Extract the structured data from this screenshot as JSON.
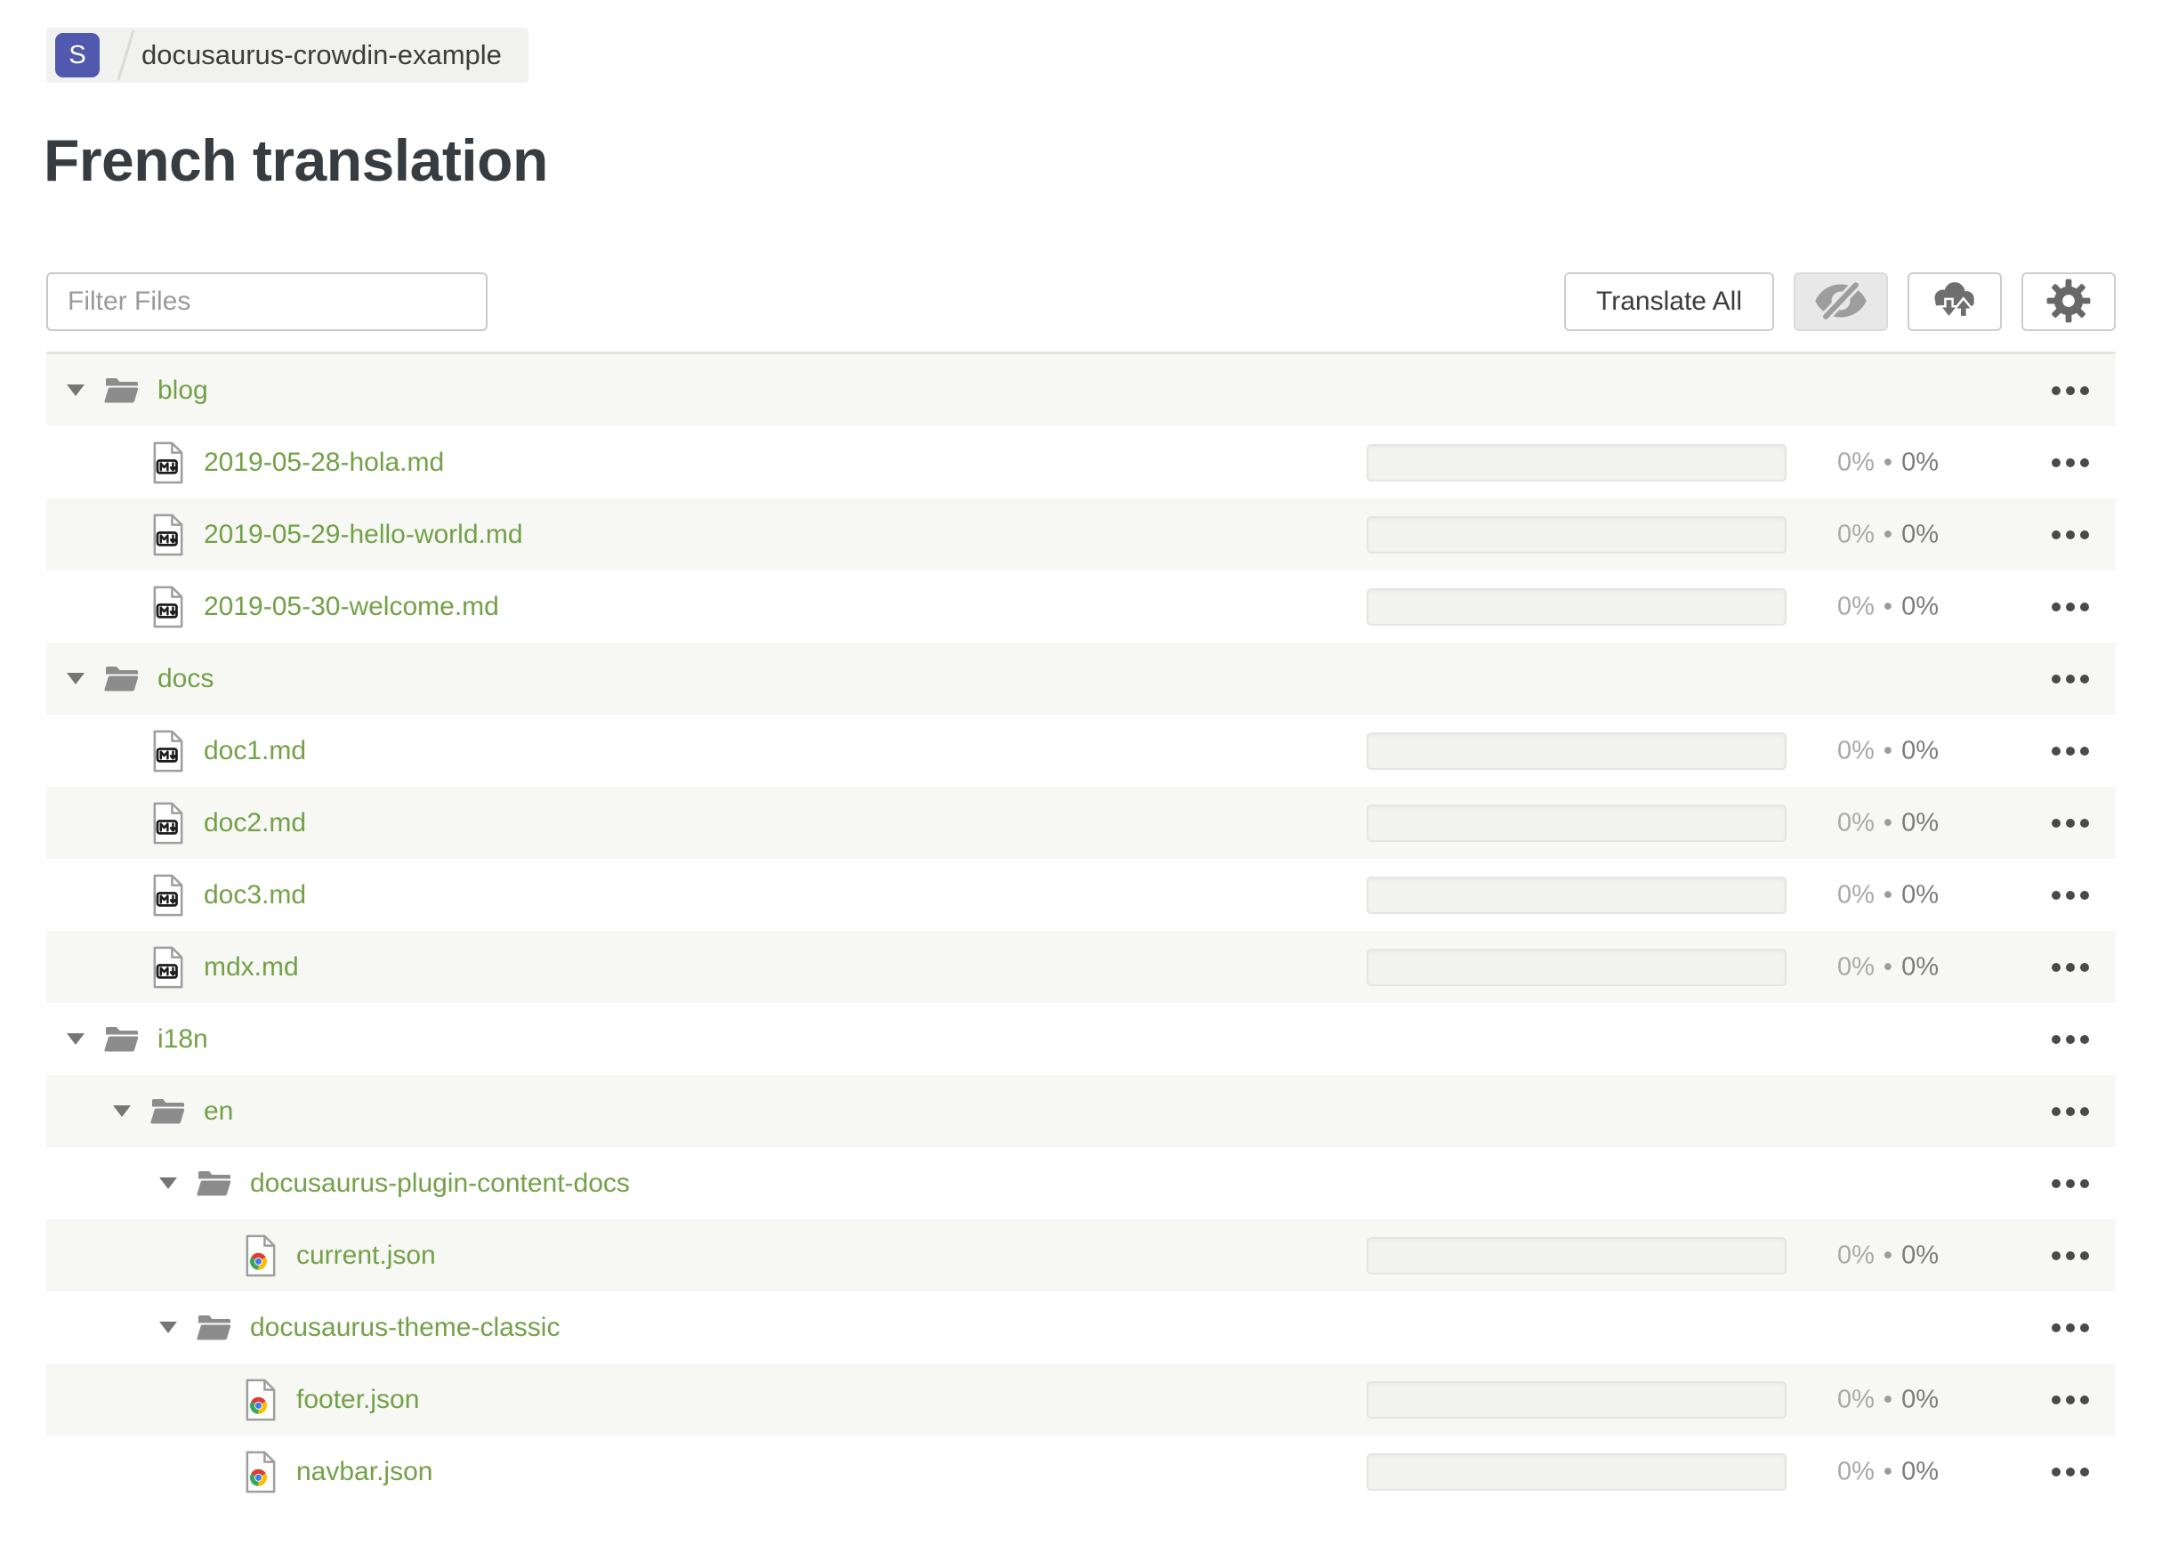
{
  "breadcrumb": {
    "avatar_letter": "S",
    "project_name": "docusaurus-crowdin-example"
  },
  "page_title": "French translation",
  "toolbar": {
    "filter_placeholder": "Filter Files",
    "translate_all_label": "Translate All",
    "hidden_toggle_icon": "eye-slash-icon",
    "transfer_icon": "cloud-download-upload-icon",
    "settings_icon": "gear-icon"
  },
  "colors": {
    "accent_green": "#72a147",
    "avatar_indigo": "#5159ae",
    "row_alt_gray": "#f7f7f4",
    "folder_gray": "#8c8c8c",
    "breadcrumb_bg": "#f1f1f0"
  },
  "tree": {
    "percent_separator": "•",
    "rows": [
      {
        "type": "folder",
        "level": 0,
        "name": "blog",
        "icon": "folder-icon"
      },
      {
        "type": "file",
        "level": 1,
        "name": "2019-05-28-hola.md",
        "icon": "markdown-file-icon",
        "translated_pct": "0%",
        "approved_pct": "0%"
      },
      {
        "type": "file",
        "level": 1,
        "name": "2019-05-29-hello-world.md",
        "icon": "markdown-file-icon",
        "translated_pct": "0%",
        "approved_pct": "0%"
      },
      {
        "type": "file",
        "level": 1,
        "name": "2019-05-30-welcome.md",
        "icon": "markdown-file-icon",
        "translated_pct": "0%",
        "approved_pct": "0%"
      },
      {
        "type": "folder",
        "level": 0,
        "name": "docs",
        "icon": "folder-icon"
      },
      {
        "type": "file",
        "level": 1,
        "name": "doc1.md",
        "icon": "markdown-file-icon",
        "translated_pct": "0%",
        "approved_pct": "0%"
      },
      {
        "type": "file",
        "level": 1,
        "name": "doc2.md",
        "icon": "markdown-file-icon",
        "translated_pct": "0%",
        "approved_pct": "0%"
      },
      {
        "type": "file",
        "level": 1,
        "name": "doc3.md",
        "icon": "markdown-file-icon",
        "translated_pct": "0%",
        "approved_pct": "0%"
      },
      {
        "type": "file",
        "level": 1,
        "name": "mdx.md",
        "icon": "markdown-file-icon",
        "translated_pct": "0%",
        "approved_pct": "0%"
      },
      {
        "type": "folder",
        "level": 0,
        "name": "i18n",
        "icon": "folder-icon"
      },
      {
        "type": "folder",
        "level": 1,
        "name": "en",
        "icon": "folder-icon"
      },
      {
        "type": "folder",
        "level": 2,
        "name": "docusaurus-plugin-content-docs",
        "icon": "folder-icon"
      },
      {
        "type": "file",
        "level": 3,
        "name": "current.json",
        "icon": "json-file-icon",
        "translated_pct": "0%",
        "approved_pct": "0%"
      },
      {
        "type": "folder",
        "level": 2,
        "name": "docusaurus-theme-classic",
        "icon": "folder-icon"
      },
      {
        "type": "file",
        "level": 3,
        "name": "footer.json",
        "icon": "json-file-icon",
        "translated_pct": "0%",
        "approved_pct": "0%"
      },
      {
        "type": "file",
        "level": 3,
        "name": "navbar.json",
        "icon": "json-file-icon",
        "translated_pct": "0%",
        "approved_pct": "0%"
      }
    ]
  }
}
